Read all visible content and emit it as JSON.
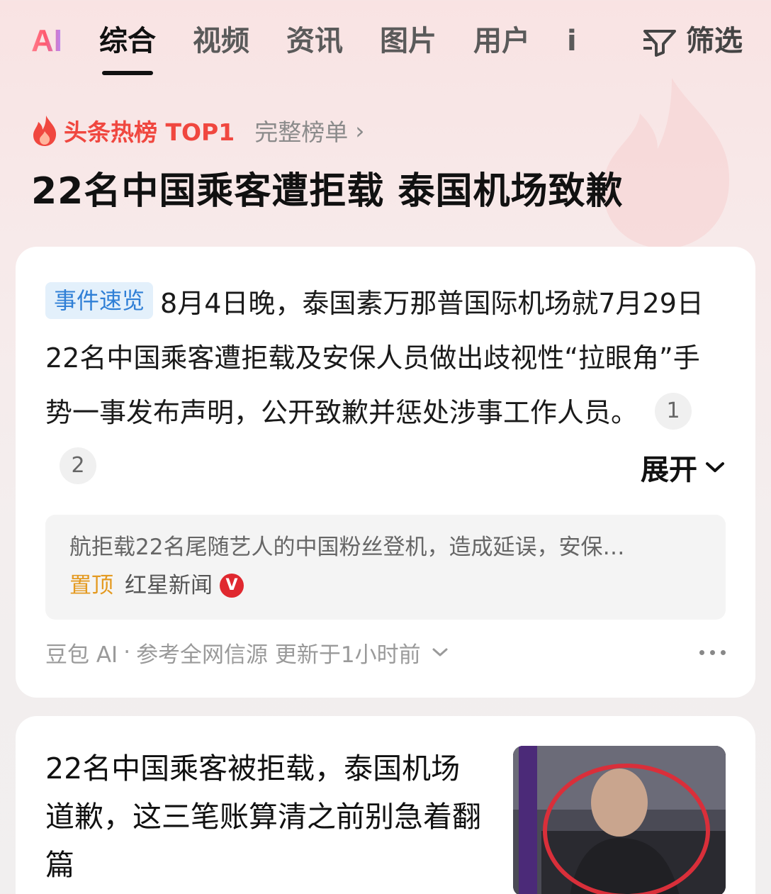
{
  "tabs": {
    "ai": "AI",
    "items": [
      "综合",
      "视频",
      "资讯",
      "图片",
      "用户"
    ],
    "more_partial": "i",
    "filter_label": "筛选"
  },
  "hot": {
    "label": "头条热榜 TOP1",
    "full_list": "完整榜单",
    "chevron": "›",
    "headline": "22名中国乘客遭拒载 泰国机场致歉"
  },
  "summary_card": {
    "tag": "事件速览",
    "text": "8月4日晚，泰国素万那普国际机场就7月29日22名中国乘客遭拒载及安保人员做出歧视性“拉眼角”手势一事发布声明，公开致歉并惩处涉事工作人员。",
    "citations": [
      "1",
      "2"
    ],
    "expand": "展开",
    "source_snippet": "航拒载22名尾随艺人的中国粉丝登机，造成延误，安保…",
    "pinned": "置顶",
    "publisher": "红星新闻",
    "verified": "V",
    "footer": {
      "ai_source": "豆包 AI",
      "dot": "·",
      "ref": "参考全网信源 更新于1小时前"
    }
  },
  "article_card": {
    "title": "22名中国乘客被拒载，泰国机场道歉，这三笔账算清之前别急着翻篇"
  },
  "colors": {
    "hot_red": "#f0473f",
    "tag_blue": "#2f7fd6",
    "pinned_orange": "#e49a21",
    "verified_red": "#e0282f"
  },
  "icons": [
    "flame-icon",
    "filter-icon",
    "chevron-right-icon",
    "chevron-down-icon",
    "more-icon",
    "verified-icon"
  ]
}
